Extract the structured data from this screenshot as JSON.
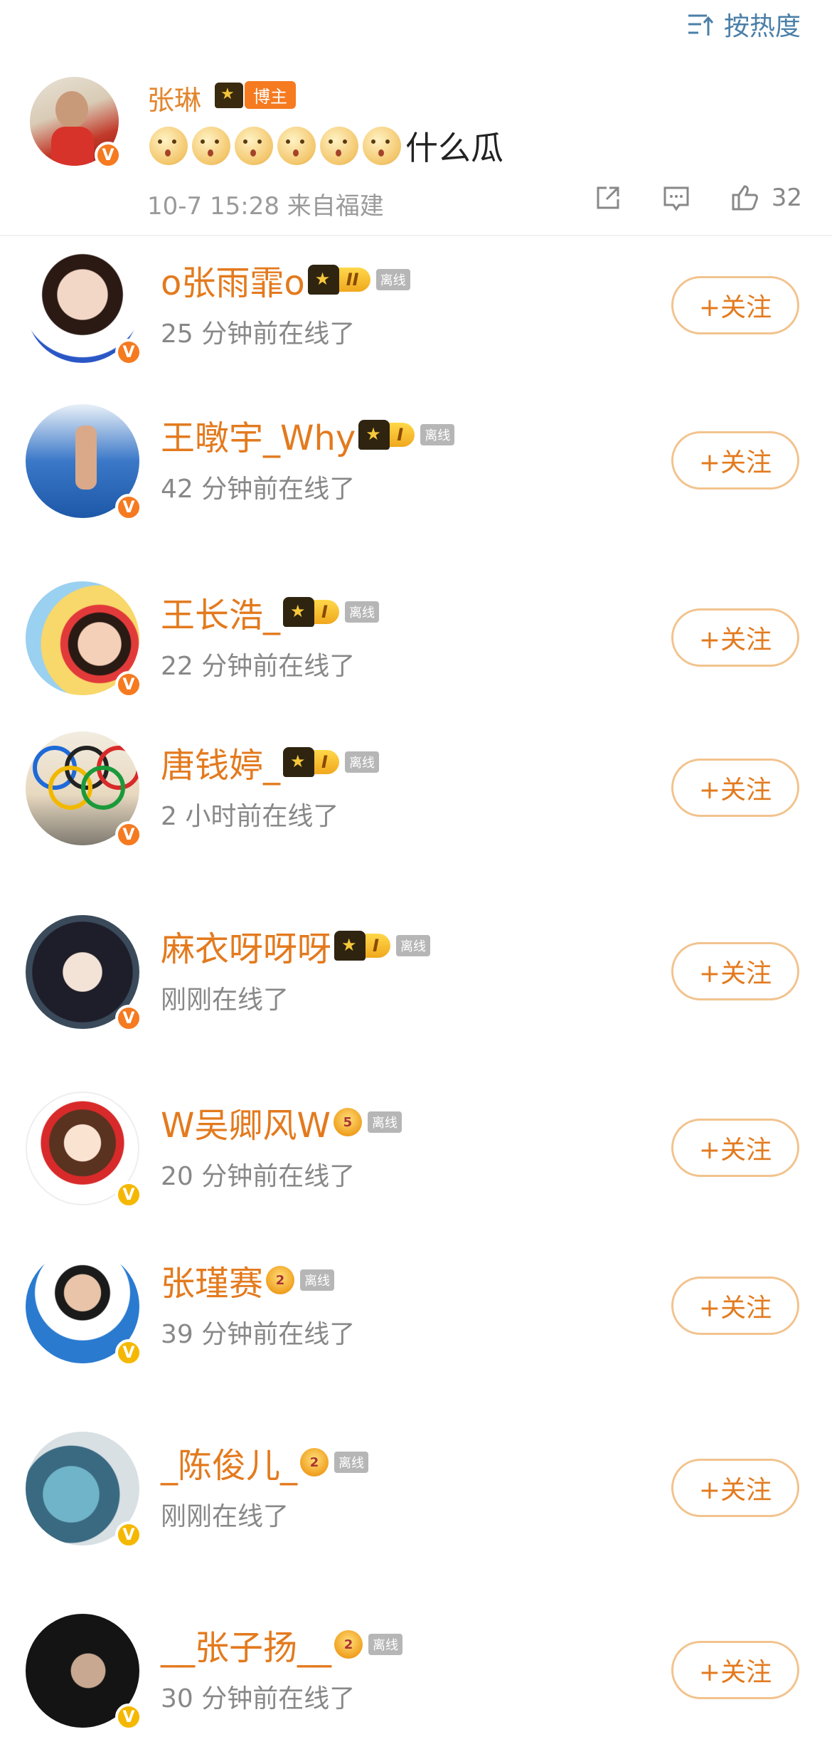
{
  "sort": {
    "label": "按热度"
  },
  "comment": {
    "author": "张琳",
    "tag": "博主",
    "emoji_count": 6,
    "text": "什么瓜",
    "date": "10-7 15:28",
    "location": "来自福建",
    "likes": "32"
  },
  "colors": {
    "name": "#e37a1e",
    "link": "#4a7fa8",
    "accent": "#f57a20"
  },
  "users": [
    {
      "name": "o张雨霏o",
      "badge": "level-II",
      "level": "II",
      "status": "25 分钟前在线了",
      "offline": "离线",
      "follow": "+关注",
      "verified": "orange"
    },
    {
      "name": "王暾宇_Why",
      "badge": "level-I",
      "level": "I",
      "status": "42 分钟前在线了",
      "offline": "离线",
      "follow": "+关注",
      "verified": "orange"
    },
    {
      "name": "王长浩_",
      "badge": "level-I",
      "level": "I",
      "status": "22 分钟前在线了",
      "offline": "离线",
      "follow": "+关注",
      "verified": "orange"
    },
    {
      "name": "唐钱婷_",
      "badge": "level-I",
      "level": "I",
      "status": "2 小时前在线了",
      "offline": "离线",
      "follow": "+关注",
      "verified": "orange"
    },
    {
      "name": "麻衣呀呀呀",
      "badge": "level-I",
      "level": "I",
      "status": "刚刚在线了",
      "offline": "离线",
      "follow": "+关注",
      "verified": "orange"
    },
    {
      "name": "W吴卿风W",
      "badge": "vip-5",
      "level": "5",
      "status": "20 分钟前在线了",
      "offline": "离线",
      "follow": "+关注",
      "verified": "yellow"
    },
    {
      "name": "张瑾赛",
      "badge": "vip-2",
      "level": "2",
      "status": "39 分钟前在线了",
      "offline": "离线",
      "follow": "+关注",
      "verified": "yellow"
    },
    {
      "name": "_陈俊儿_",
      "badge": "vip-2",
      "level": "2",
      "status": "刚刚在线了",
      "offline": "离线",
      "follow": "+关注",
      "verified": "yellow"
    },
    {
      "name": "__张子扬__",
      "badge": "vip-2",
      "level": "2",
      "status": "30 分钟前在线了",
      "offline": "离线",
      "follow": "+关注",
      "verified": "yellow"
    }
  ]
}
